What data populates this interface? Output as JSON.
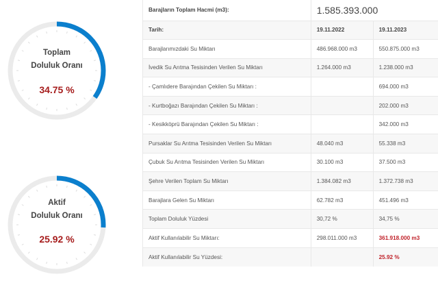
{
  "gauges": [
    {
      "label_line1": "Toplam",
      "label_line2": "Doluluk Oranı",
      "value_text": "34.75 %",
      "fraction": 0.3475,
      "color": "#0b7fcd"
    },
    {
      "label_line1": "Aktif",
      "label_line2": "Doluluk Oranı",
      "value_text": "25.92 %",
      "fraction": 0.2592,
      "color": "#0b7fcd"
    }
  ],
  "table": {
    "total_label": "Barajların Toplam Hacmi (m3):",
    "total_value": "1.585.393.000",
    "date_label": "Tarih:",
    "date_1": "19.11.2022",
    "date_2": "19.11.2023",
    "rows": [
      {
        "label": "Barajlarımızdaki Su Miktarı",
        "v1": "486.968.000 m3",
        "v2": "550.875.000 m3"
      },
      {
        "label": "İvedik Su Arıtma Tesisinden Verilen Su Miktarı",
        "v1": "1.264.000 m3",
        "v2": "1.238.000 m3"
      },
      {
        "label": "- Çamlıdere Barajından Çekilen Su Miktarı :",
        "v1": "",
        "v2": "694.000 m3"
      },
      {
        "label": "- Kurtboğazı Barajından Çekilen Su Miktarı :",
        "v1": "",
        "v2": "202.000 m3"
      },
      {
        "label": "- Kesikköprü Barajından Çekilen Su Miktarı :",
        "v1": "",
        "v2": "342.000 m3"
      },
      {
        "label": "Pursaklar Su Arıtma Tesisinden Verilen Su Miktarı",
        "v1": "48.040 m3",
        "v2": "55.338 m3"
      },
      {
        "label": "Çubuk Su Arıtma Tesisinden Verilen Su Miktarı",
        "v1": "30.100 m3",
        "v2": "37.500 m3"
      },
      {
        "label": "Şehre Verilen Toplam Su Miktarı",
        "v1": "1.384.082 m3",
        "v2": "1.372.738 m3"
      },
      {
        "label": "Barajlara Gelen Su Miktarı",
        "v1": "62.782 m3",
        "v2": "451.496 m3"
      },
      {
        "label": "Toplam Doluluk Yüzdesi",
        "v1": "30,72 %",
        "v2": "34,75 %"
      },
      {
        "label": "Aktif Kullanılabilir Su Miktarı:",
        "v1": "298.011.000 m3",
        "v2": "361.918.000 m3"
      },
      {
        "label": "Aktif Kullanılabilir Su Yüzdesi:",
        "v1": "",
        "v2": "25.92 %"
      }
    ]
  }
}
